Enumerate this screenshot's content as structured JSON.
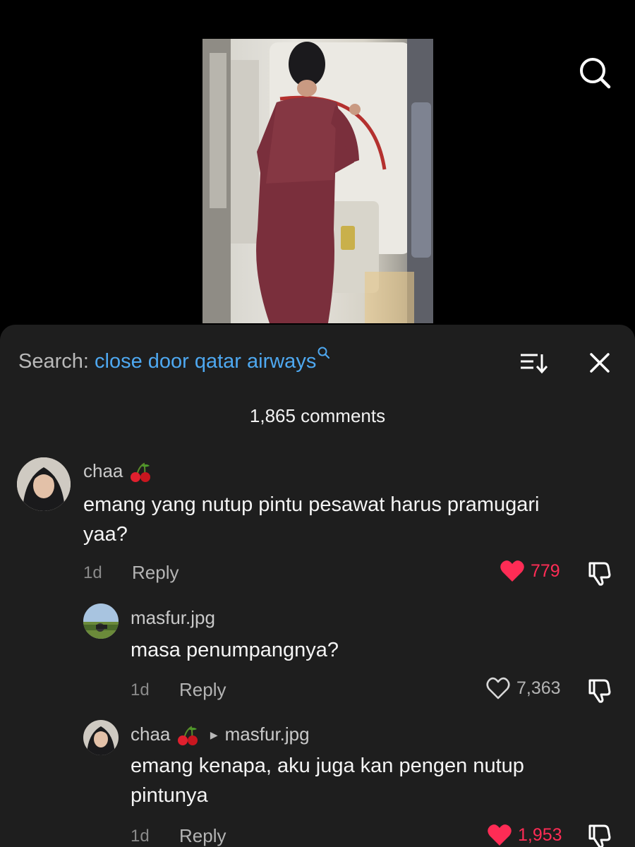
{
  "header": {
    "search_prefix": "Search: ",
    "search_query": "close door qatar airways",
    "comment_count": "1,865 comments"
  },
  "icons": {
    "top_search": "search-icon",
    "sort": "sort-icon",
    "close": "close-icon",
    "like": "heart-icon",
    "dislike": "thumbs-down-icon"
  },
  "colors": {
    "accent_like": "#fe2c55",
    "link_blue": "#4ea8f0",
    "sheet_bg": "#1e1e1e"
  },
  "comments": [
    {
      "username": "chaa",
      "text_line1": "emang yang nutup pintu pesawat harus pramugari",
      "text_line2": "yaa?",
      "time": "1d",
      "reply_label": "Reply",
      "likes": "779",
      "liked": true
    },
    {
      "username": "masfur.jpg",
      "text_line1": "masa penumpangnya?",
      "time": "1d",
      "reply_label": "Reply",
      "likes": "7,363",
      "liked": false
    },
    {
      "username": "chaa",
      "reply_to": "masfur.jpg",
      "text_line1": "emang kenapa, aku juga kan pengen nutup",
      "text_line2": "pintunya",
      "time": "1d",
      "reply_label": "Reply",
      "likes": "1,953",
      "liked": true
    }
  ]
}
